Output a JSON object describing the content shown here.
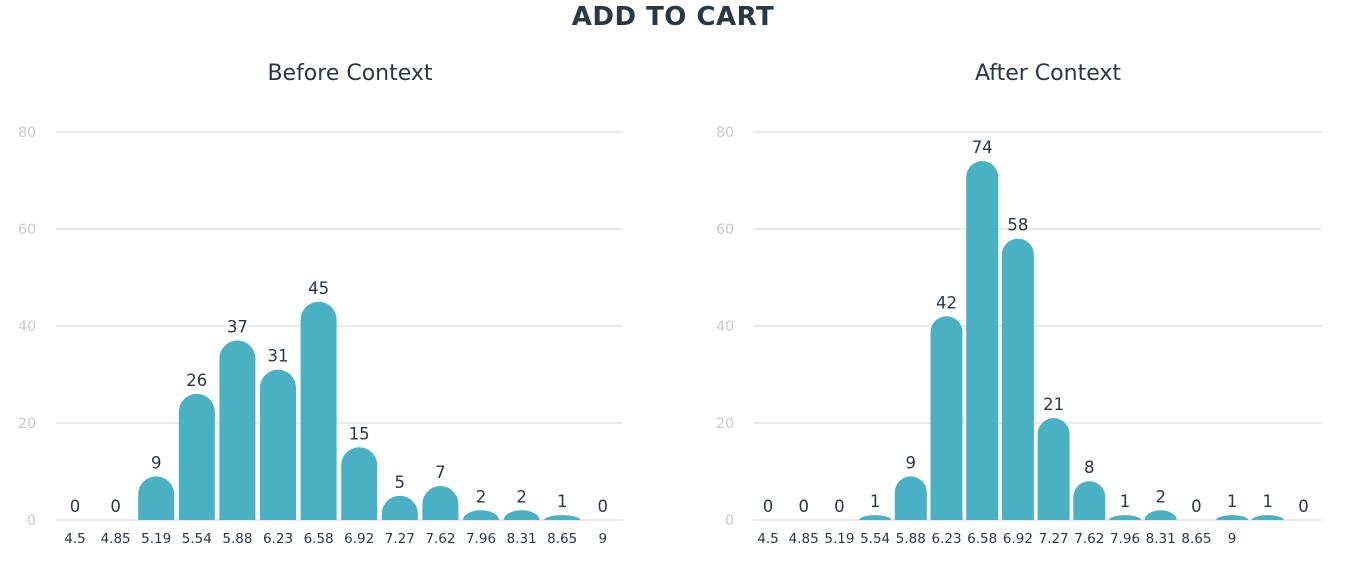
{
  "title": "ADD TO CART",
  "colors": {
    "bar": "#4ab0c4",
    "grid": "#d3d6da",
    "text": "#2a3745",
    "tick": "#c5c9ce"
  },
  "chart_data": [
    {
      "type": "bar",
      "title": "Before Context",
      "categories": [
        "4.5",
        "4.85",
        "5.19",
        "5.54",
        "5.88",
        "6.23",
        "6.58",
        "6.92",
        "7.27",
        "7.62",
        "7.96",
        "8.31",
        "8.65",
        "9"
      ],
      "values": [
        0,
        0,
        9,
        26,
        37,
        31,
        45,
        15,
        5,
        7,
        2,
        2,
        1,
        0
      ],
      "yticks": [
        0,
        20,
        40,
        60,
        80
      ],
      "ylim": [
        0,
        80
      ],
      "grid": true
    },
    {
      "type": "bar",
      "title": "After Context",
      "categories": [
        "4.5",
        "4.85",
        "5.19",
        "5.54",
        "5.88",
        "6.23",
        "6.58",
        "6.92",
        "7.27",
        "7.62",
        "7.96",
        "8.31",
        "8.65",
        "9",
        "",
        ""
      ],
      "values": [
        0,
        0,
        0,
        1,
        9,
        42,
        74,
        58,
        21,
        8,
        1,
        2,
        0,
        1,
        1,
        0
      ],
      "yticks": [
        0,
        20,
        40,
        60,
        80
      ],
      "ylim": [
        0,
        80
      ],
      "grid": true
    }
  ]
}
